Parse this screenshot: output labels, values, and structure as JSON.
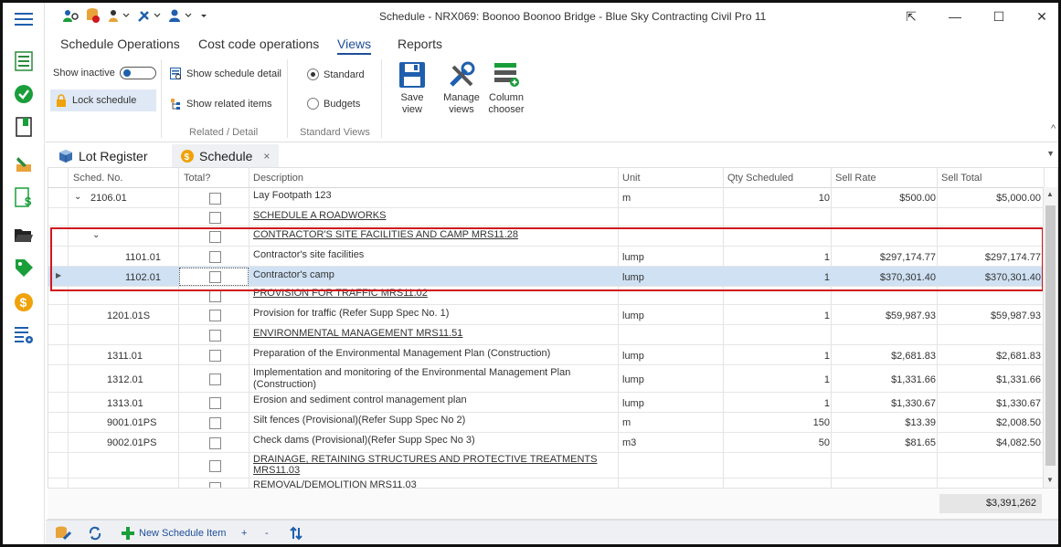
{
  "window": {
    "title": "Schedule - NRX069: Boonoo Boonoo Bridge  - Blue Sky Contracting Civil Pro 11",
    "controls": {
      "restore_glyph": "⇱",
      "minimize_glyph": "—",
      "maximize_glyph": "☐",
      "close_glyph": "✕"
    }
  },
  "ribbon_tabs": [
    "Schedule Operations",
    "Cost code operations",
    "Views",
    "Reports"
  ],
  "ribbon": {
    "show_inactive_label": "Show inactive",
    "lock_schedule_label": "Lock schedule",
    "show_schedule_detail_label": "Show schedule detail",
    "show_related_items_label": "Show related items",
    "related_detail_group_label": "Related / Detail",
    "standard_label": "Standard",
    "budgets_label": "Budgets",
    "standard_views_group_label": "Standard Views",
    "save_view_label": "Save view",
    "manage_views_label": "Manage views",
    "column_chooser_label": "Column chooser"
  },
  "doc_tabs": {
    "lot_register": "Lot Register",
    "schedule": "Schedule",
    "close_glyph": "×"
  },
  "grid": {
    "columns": [
      "Sched. No.",
      "Total?",
      "Description",
      "Unit",
      "Qty Scheduled",
      "Sell Rate",
      "Sell Total"
    ],
    "rows": [
      {
        "sched_no": "2106.01",
        "desc": "Lay Footpath  123",
        "unit": "m",
        "qty": "10",
        "rate": "$500.00",
        "total": "$5,000.00",
        "underline": false
      },
      {
        "sched_no": "",
        "desc": "SCHEDULE A ROADWORKS",
        "unit": "",
        "qty": "",
        "rate": "",
        "total": "",
        "underline": true
      },
      {
        "sched_no": "",
        "desc": "CONTRACTOR'S SITE FACILITIES AND CAMP  MRS11.28",
        "unit": "",
        "qty": "",
        "rate": "",
        "total": "",
        "underline": true
      },
      {
        "sched_no": "1101.01",
        "desc": "Contractor's site facilities",
        "unit": "lump",
        "qty": "1",
        "rate": "$297,174.77",
        "total": "$297,174.77",
        "underline": false
      },
      {
        "sched_no": "1102.01",
        "desc": "Contractor's camp",
        "unit": "lump",
        "qty": "1",
        "rate": "$370,301.40",
        "total": "$370,301.40",
        "underline": false
      },
      {
        "sched_no": "",
        "desc": "PROVISION FOR TRAFFIC  MRS11.02",
        "unit": "",
        "qty": "",
        "rate": "",
        "total": "",
        "underline": true
      },
      {
        "sched_no": "1201.01S",
        "desc": "Provision for traffic (Refer Supp Spec No. 1)",
        "unit": "lump",
        "qty": "1",
        "rate": "$59,987.93",
        "total": "$59,987.93",
        "underline": false
      },
      {
        "sched_no": "",
        "desc": "ENVIRONMENTAL MANAGEMENT  MRS11.51",
        "unit": "",
        "qty": "",
        "rate": "",
        "total": "",
        "underline": true
      },
      {
        "sched_no": "1311.01",
        "desc": "Preparation of the Environmental Management Plan (Construction)",
        "unit": "lump",
        "qty": "1",
        "rate": "$2,681.83",
        "total": "$2,681.83",
        "underline": false
      },
      {
        "sched_no": "1312.01",
        "desc": "Implementation and monitoring of the Environmental Management Plan",
        "desc2": "(Construction)",
        "unit": "lump",
        "qty": "1",
        "rate": "$1,331.66",
        "total": "$1,331.66",
        "underline": false
      },
      {
        "sched_no": "1313.01",
        "desc": "Erosion and sediment control management plan",
        "unit": "lump",
        "qty": "1",
        "rate": "$1,330.67",
        "total": "$1,330.67",
        "underline": false
      },
      {
        "sched_no": "9001.01PS",
        "desc": "Silt fences (Provisional)(Refer Supp Spec No 2)",
        "unit": "m",
        "qty": "150",
        "rate": "$13.39",
        "total": "$2,008.50",
        "underline": false
      },
      {
        "sched_no": "9002.01PS",
        "desc": "Check dams (Provisional)(Refer Supp Spec No 3)",
        "unit": "m3",
        "qty": "50",
        "rate": "$81.65",
        "total": "$4,082.50",
        "underline": false
      },
      {
        "sched_no": "",
        "desc": "DRAINAGE, RETAINING STRUCTURES AND PROTECTIVE TREATMENTS",
        "desc2": "MRS11.03",
        "unit": "",
        "qty": "",
        "rate": "",
        "total": "",
        "underline": true
      },
      {
        "sched_no": "",
        "desc": "REMOVAL/DEMOLITION  MRS11.03",
        "unit": "",
        "qty": "",
        "rate": "",
        "total": "",
        "underline": true
      }
    ],
    "grand_total": "$3,391,262"
  },
  "statusbar": {
    "new_item_label": "New Schedule Item",
    "plus_glyph": "+",
    "minus_glyph": "-"
  },
  "icons": {
    "hamburger": "menu-icon",
    "accent": "#1f5fad"
  }
}
